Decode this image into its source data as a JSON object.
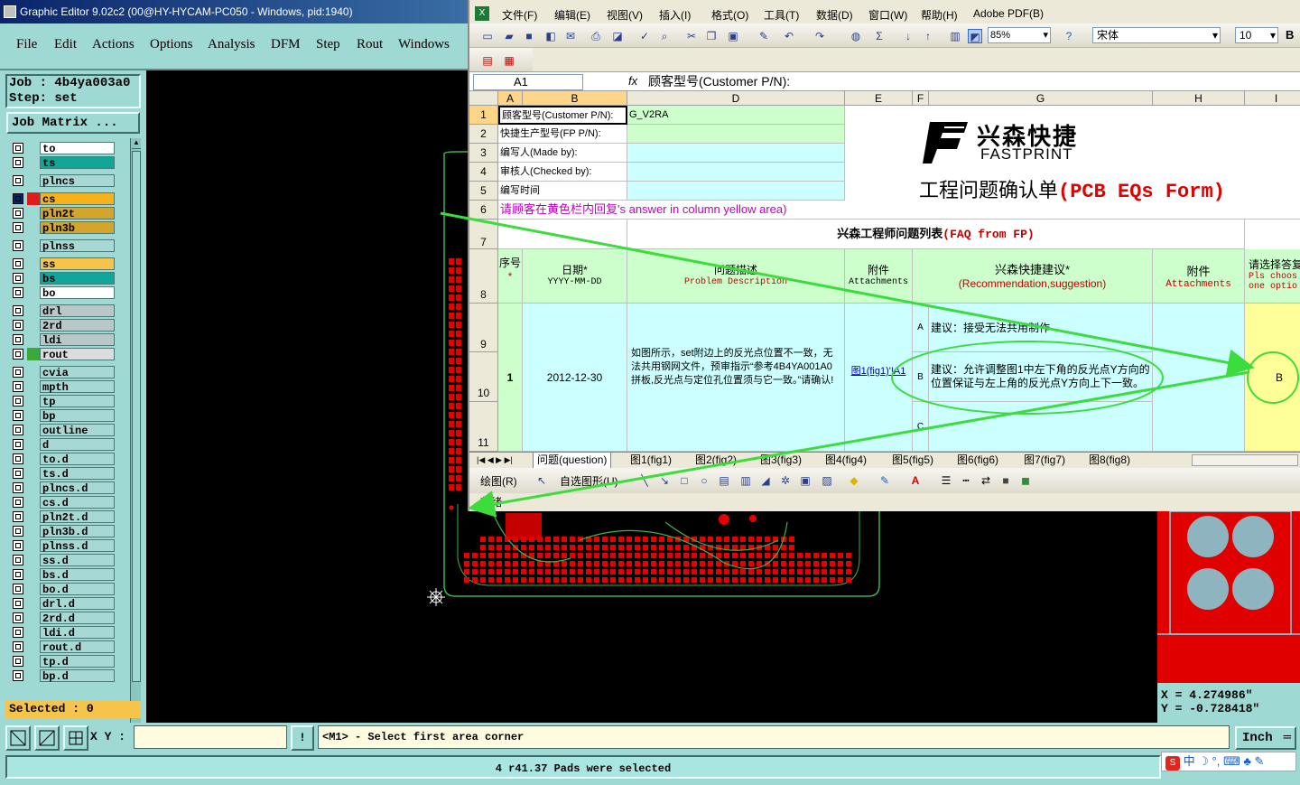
{
  "ge": {
    "title": "Graphic Editor 9.02c2 (00@HY-HYCAM-PC050 - Windows, pid:1940)",
    "menu": [
      "File",
      "Edit",
      "Actions",
      "Options",
      "Analysis",
      "DFM",
      "Step",
      "Rout",
      "Windows"
    ],
    "job_line": "Job : 4b4ya003a0",
    "step_line": "Step: set",
    "job_matrix": "Job Matrix ...",
    "layers": [
      {
        "name": "to",
        "color": "#ffffff"
      },
      {
        "name": "ts",
        "color": "#12a69a"
      },
      {
        "name": "plncs",
        "color": "#a8d8d4"
      },
      {
        "name": "cs",
        "color": "#f5b21b"
      },
      {
        "name": "pln2t",
        "color": "#d4a52c"
      },
      {
        "name": "pln3b",
        "color": "#d4a52c"
      },
      {
        "name": "plnss",
        "color": "#a8d8d4"
      },
      {
        "name": "ss",
        "color": "#f7c44b"
      },
      {
        "name": "bs",
        "color": "#12a69a"
      },
      {
        "name": "bo",
        "color": "#ffffff"
      },
      {
        "name": "drl",
        "color": "#b9c7c9"
      },
      {
        "name": "2rd",
        "color": "#b9c7c9"
      },
      {
        "name": "ldi",
        "color": "#b9c7c9"
      },
      {
        "name": "rout",
        "color": "#dcdcdc"
      },
      {
        "name": "cvia",
        "color": "#a8d8d4"
      },
      {
        "name": "mpth",
        "color": "#a8d8d4"
      },
      {
        "name": "tp",
        "color": "#a8d8d4"
      },
      {
        "name": "bp",
        "color": "#a8d8d4"
      },
      {
        "name": "outline",
        "color": "#a8d8d4"
      },
      {
        "name": "d",
        "color": "#a8d8d4"
      },
      {
        "name": "to.d",
        "color": "#a8d8d4"
      },
      {
        "name": "ts.d",
        "color": "#a8d8d4"
      },
      {
        "name": "plncs.d",
        "color": "#a8d8d4"
      },
      {
        "name": "cs.d",
        "color": "#a8d8d4"
      },
      {
        "name": "pln2t.d",
        "color": "#a8d8d4"
      },
      {
        "name": "pln3b.d",
        "color": "#a8d8d4"
      },
      {
        "name": "plnss.d",
        "color": "#a8d8d4"
      },
      {
        "name": "ss.d",
        "color": "#a8d8d4"
      },
      {
        "name": "bs.d",
        "color": "#a8d8d4"
      },
      {
        "name": "bo.d",
        "color": "#a8d8d4"
      },
      {
        "name": "drl.d",
        "color": "#a8d8d4"
      },
      {
        "name": "2rd.d",
        "color": "#a8d8d4"
      },
      {
        "name": "ldi.d",
        "color": "#a8d8d4"
      },
      {
        "name": "rout.d",
        "color": "#a8d8d4"
      },
      {
        "name": "tp.d",
        "color": "#a8d8d4"
      },
      {
        "name": "bp.d",
        "color": "#a8d8d4"
      }
    ],
    "selected": "Selected : 0",
    "xy_label": "X Y :",
    "xy_value": "",
    "prompt": "<M1> - Select first area corner",
    "unit": "Inch",
    "message": "4 r41.37 Pads were selected",
    "coord_x": "X = 4.274986\"",
    "coord_y": "Y = -0.728418\""
  },
  "excel": {
    "menu": [
      "文件(F)",
      "编辑(E)",
      "视图(V)",
      "插入(I)",
      "格式(O)",
      "工具(T)",
      "数据(D)",
      "窗口(W)",
      "帮助(H)",
      "Adobe PDF(B)"
    ],
    "zoom": "85%",
    "font": "宋体",
    "font_size": "10",
    "bold": "B",
    "name_box": "A1",
    "fx": "fx",
    "formula": "顾客型号(Customer P/N):",
    "columns": [
      "A",
      "B",
      "D",
      "E",
      "F",
      "G",
      "H",
      "I"
    ],
    "rows": [
      "1",
      "2",
      "3",
      "4",
      "5",
      "6",
      "7",
      "8",
      "9",
      "10",
      "11"
    ],
    "r1": "顾客型号(Customer P/N):",
    "r1_val": "G_V2RA",
    "r2": "快捷生产型号(FP P/N):",
    "r3": "编写人(Made by):",
    "r4": "审核人(Checked by):",
    "r5": "编写时间",
    "r6": "请顾客在黄色栏内回复's answer in column yellow area)",
    "logo_cn": "兴森快捷",
    "logo_en": "FASTPRINT",
    "form_title_cn": "工程问题确认单",
    "form_title_en": "(PCB EQs Form)",
    "faq_title_cn": "兴森工程师问题列表",
    "faq_title_en": "(FAQ from FP)",
    "h_no": "序号",
    "h_date": "日期*",
    "h_date_sub": "YYYY-MM-DD",
    "h_desc": "问题描述",
    "h_desc_sub": "Problem Description",
    "h_attach": "附件",
    "h_attach_sub": "Attachments",
    "h_rec": "兴森快捷建议*",
    "h_rec_sub": "(Recommendation,suggestion)",
    "h_attach2": "附件",
    "h_attach2_sub": "Attachments",
    "h_choose": "请选择答复",
    "h_choose_sub1": "Pls choos",
    "h_choose_sub2": "one optio",
    "no": "1",
    "date": "2012-12-30",
    "desc": "如图所示，set附边上的反光点位置不一致，无法共用钢网文件，预审指示“参考4B4YA001A0拼板,反光点与定位孔位置须与它一致。”请确认!",
    "attach_link": "图1(fig1)'!A1",
    "opt_a": "A",
    "opt_b": "B",
    "opt_c": "C",
    "rec_a": "建议：接受无法共用制作",
    "rec_b": "建议：允许调整图1中左下角的反光点Y方向的位置保证与左上角的反光点Y方向上下一致。",
    "answer": "B",
    "sheet_tabs": [
      "问题(question)",
      "图1(fig1)",
      "图2(fig2)",
      "图3(fig3)",
      "图4(fig4)",
      "图5(fig5)",
      "图6(fig6)",
      "图7(fig7)",
      "图8(fig8)"
    ],
    "draw_label": "绘图(R)",
    "autoshape_label": "自选图形(U)",
    "status": "就绪"
  },
  "ime": "中"
}
